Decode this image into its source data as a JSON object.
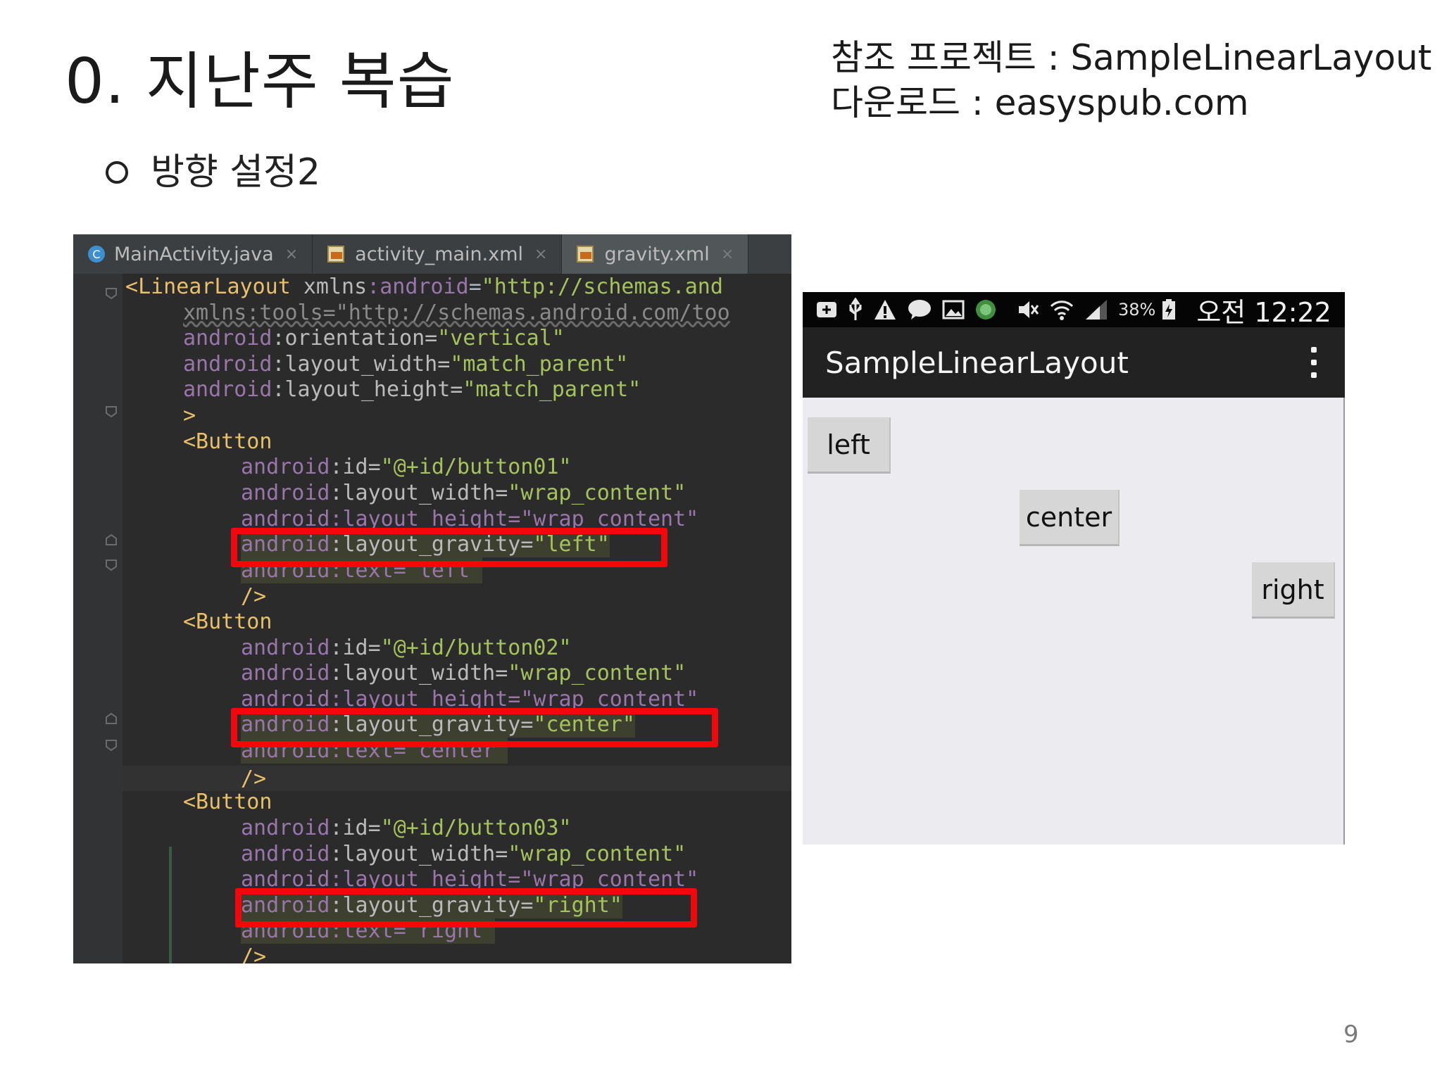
{
  "slide": {
    "title": "0. 지난주 복습",
    "reference_line1": "참조 프로젝트 : SampleLinearLayout",
    "reference_line2": "다운로드 : easyspub.com",
    "bullet": "방향 설정2",
    "page_number": "9"
  },
  "ide": {
    "tabs": [
      {
        "label": "MainActivity.java",
        "icon": "java-class-icon"
      },
      {
        "label": "activity_main.xml",
        "icon": "xml-file-icon"
      },
      {
        "label": "gravity.xml",
        "icon": "xml-file-icon"
      }
    ],
    "close_glyph": "×",
    "code": {
      "l0_open": "<",
      "l0_tag": "LinearLayout",
      "l0_attr": " xmlns",
      "l0_ns": ":android",
      "l0_eq": "=",
      "l0_val": "\"http://schemas.and",
      "l1": "xmlns:tools=\"http://schemas.android.com/too",
      "l2_ns": "android",
      "l2_attr": ":orientation=",
      "l2_val": "\"vertical\"",
      "l3_ns": "android",
      "l3_attr": ":layout_width=",
      "l3_val": "\"match_parent\"",
      "l4_ns": "android",
      "l4_attr": ":layout_height=",
      "l4_val": "\"match_parent\"",
      "l5": ">",
      "b1_tag": "<Button",
      "b1_id_ns": "android",
      "b1_id_attr": ":id=",
      "b1_id_val": "\"@+id/button01\"",
      "b1_w_ns": "android",
      "b1_w_attr": ":layout_width=",
      "b1_w_val": "\"wrap_content\"",
      "b1_h": "android:layout_height=\"wrap_content\"",
      "b1_g_ns": "android",
      "b1_g_attr": ":layout_gravity=",
      "b1_g_val": "\"left\"",
      "b1_t": "android:text=\"left\"",
      "b1_close": "/>",
      "b2_tag": "<Button",
      "b2_id_ns": "android",
      "b2_id_attr": ":id=",
      "b2_id_val": "\"@+id/button02\"",
      "b2_w_ns": "android",
      "b2_w_attr": ":layout_width=",
      "b2_w_val": "\"wrap_content\"",
      "b2_h": "android:layout_height=\"wrap_content\"",
      "b2_g_ns": "android",
      "b2_g_attr": ":layout_gravity=",
      "b2_g_val": "\"center\"",
      "b2_t": "android:text=\"center\"",
      "b2_close": "/>",
      "b3_tag": "<Button",
      "b3_id_ns": "android",
      "b3_id_attr": ":id=",
      "b3_id_val": "\"@+id/button03\"",
      "b3_w_ns": "android",
      "b3_w_attr": ":layout_width=",
      "b3_w_val": "\"wrap_content\"",
      "b3_h": "android:layout_height=\"wrap_content\"",
      "b3_g_ns": "android",
      "b3_g_attr": ":layout_gravity=",
      "b3_g_val": "\"right\"",
      "b3_t": "android:text=\"right\"",
      "b3_close": "/>"
    }
  },
  "phone": {
    "status": {
      "battery": "38%",
      "time": "오전 12:22"
    },
    "app_title": "SampleLinearLayout",
    "buttons": {
      "left": "left",
      "center": "center",
      "right": "right"
    }
  },
  "colors": {
    "highlight_box": "#f2070d",
    "ide_background": "#2b2b2b",
    "xml_tag": "#e8bf6a",
    "xml_namespace": "#9876aa",
    "xml_string": "#a5c25c"
  }
}
